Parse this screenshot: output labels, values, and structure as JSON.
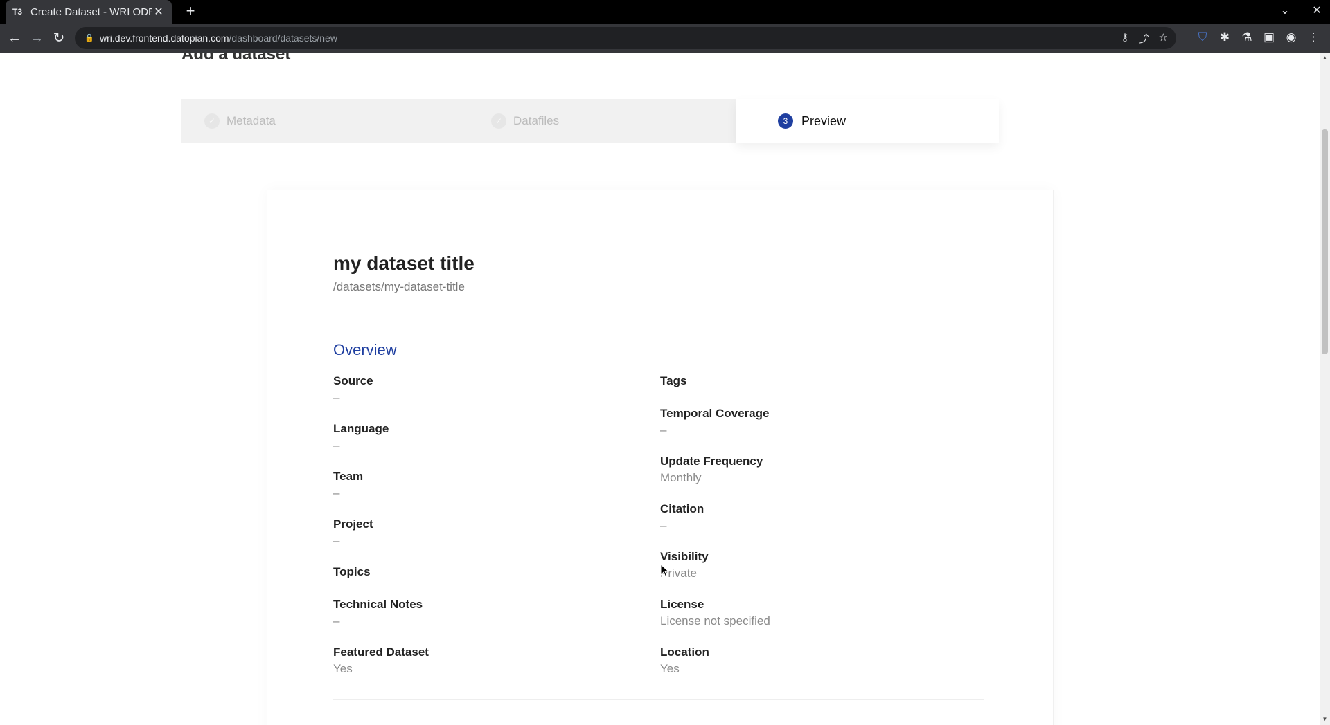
{
  "browser": {
    "tab_title": "Create Dataset - WRI ODP",
    "tab_favicon": "T3",
    "url_host": "wri.dev.frontend.datopian.com",
    "url_path": "/dashboard/datasets/new"
  },
  "page": {
    "heading": "Add a dataset",
    "steps": [
      {
        "label": "Metadata",
        "state": "done"
      },
      {
        "label": "Datafiles",
        "state": "done"
      },
      {
        "label": "Preview",
        "state": "current",
        "number": "3"
      }
    ]
  },
  "dataset": {
    "title": "my dataset title",
    "path": "/datasets/my-dataset-title",
    "overview_heading": "Overview",
    "left_fields": [
      {
        "label": "Source",
        "value": "–"
      },
      {
        "label": "Language",
        "value": "–"
      },
      {
        "label": "Team",
        "value": "–"
      },
      {
        "label": "Project",
        "value": "–"
      },
      {
        "label": "Topics",
        "value": ""
      },
      {
        "label": "Technical Notes",
        "value": "–"
      },
      {
        "label": "Featured Dataset",
        "value": "Yes"
      }
    ],
    "right_fields": [
      {
        "label": "Tags",
        "value": ""
      },
      {
        "label": "Temporal Coverage",
        "value": "–"
      },
      {
        "label": "Update Frequency",
        "value": "Monthly"
      },
      {
        "label": "Citation",
        "value": "–"
      },
      {
        "label": "Visibility",
        "value": "Private"
      },
      {
        "label": "License",
        "value": "License not specified"
      },
      {
        "label": "Location",
        "value": "Yes"
      }
    ]
  },
  "colors": {
    "accent": "#1f3fa0",
    "step_inactive_bg": "#f1f1f1"
  }
}
